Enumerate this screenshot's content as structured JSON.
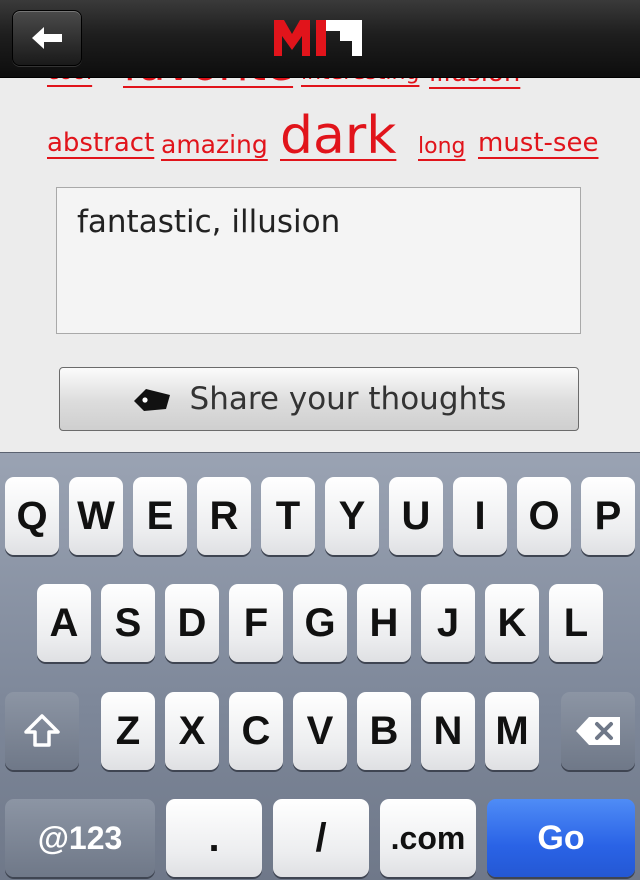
{
  "header": {
    "back_icon": "back-arrow-icon",
    "logo_icon": "mf-logo-icon"
  },
  "tags_partial": [
    "cool",
    "favorite",
    "interesting",
    "illusion"
  ],
  "tags": [
    "abstract",
    "amazing",
    "dark",
    "long",
    "must-see"
  ],
  "comment": {
    "value": "fantastic, illusion"
  },
  "share_button": {
    "label": "Share your thoughts",
    "icon": "tag-icon"
  },
  "keyboard": {
    "row1": [
      "Q",
      "W",
      "E",
      "R",
      "T",
      "Y",
      "U",
      "I",
      "O",
      "P"
    ],
    "row2": [
      "A",
      "S",
      "D",
      "F",
      "G",
      "H",
      "J",
      "K",
      "L"
    ],
    "row3": [
      "Z",
      "X",
      "C",
      "V",
      "B",
      "N",
      "M"
    ],
    "shift_icon": "shift-icon",
    "delete_icon": "backspace-icon",
    "numbers_label": "@123",
    "period_label": ".",
    "slash_label": "/",
    "com_label": ".com",
    "go_label": "Go"
  },
  "colors": {
    "tag": "#e1141b",
    "go": "#2a63e6",
    "header": "#1e1e1e"
  }
}
